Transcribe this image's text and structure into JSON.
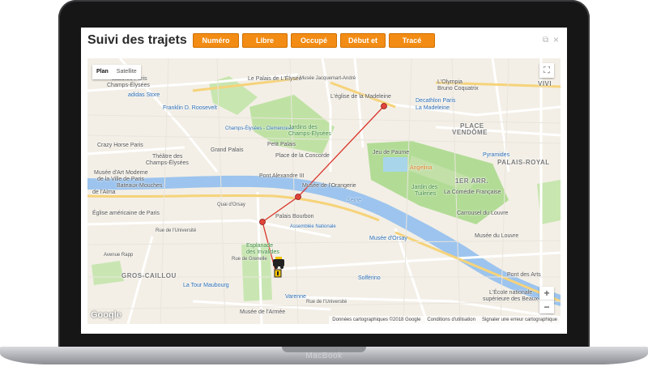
{
  "device": {
    "brand": "MacBook"
  },
  "app": {
    "title": "Suivi des trajets"
  },
  "filters": [
    {
      "label": "Numéro"
    },
    {
      "label": "Libre"
    },
    {
      "label": "Occupé"
    },
    {
      "label": "Début et"
    },
    {
      "label": "Tracé"
    }
  ],
  "window": {
    "popout_icon": "⧉",
    "close_icon": "×"
  },
  "map": {
    "type_control": {
      "plan": "Plan",
      "satellite": "Satellite"
    },
    "fullscreen_icon": "⛶",
    "zoom_in": "+",
    "zoom_out": "−",
    "logo": "Google",
    "attribution": {
      "data": "Données cartographiques ©2018 Google",
      "terms": "Conditions d'utilisation",
      "report": "Signaler une erreur cartographique"
    },
    "route_color": "#d9352c",
    "labels": [
      {
        "text": "Ladurée Paris",
        "cls": "dark"
      },
      {
        "text": "Champs-Élysées",
        "cls": "dark"
      },
      {
        "text": "adidas Store",
        "cls": "blue"
      },
      {
        "text": "Le Palais de L'Élysée",
        "cls": "dark"
      },
      {
        "text": "Musée Jacquemart-André",
        "cls": "dark small"
      },
      {
        "text": "L'Olympia",
        "cls": "dark"
      },
      {
        "text": "Bruno Coquatrix",
        "cls": "dark"
      },
      {
        "text": "VIVI",
        "cls": "big"
      },
      {
        "text": "Franklin D. Roosevelt",
        "cls": "blue"
      },
      {
        "text": "L'église de la Madeleine",
        "cls": "dark"
      },
      {
        "text": "Decathlon Paris",
        "cls": "blue"
      },
      {
        "text": "La Madeleine",
        "cls": "blue"
      },
      {
        "text": "Champs-Élysées - Clemenceau",
        "cls": "blue small"
      },
      {
        "text": "Jardins des",
        "cls": "green"
      },
      {
        "text": "Champs-Élysées",
        "cls": "green"
      },
      {
        "text": "PLACE",
        "cls": "big"
      },
      {
        "text": "VENDÔME",
        "cls": "big"
      },
      {
        "text": "Crazy Horse Paris",
        "cls": "dark"
      },
      {
        "text": "Petit Palais",
        "cls": "dark"
      },
      {
        "text": "Théâtre des",
        "cls": "dark"
      },
      {
        "text": "Champs-Élysées",
        "cls": "dark"
      },
      {
        "text": "Grand Palais",
        "cls": "dark"
      },
      {
        "text": "Place de la Concorde",
        "cls": "dark"
      },
      {
        "text": "Pyramides",
        "cls": "blue"
      },
      {
        "text": "Jeu de Paume",
        "cls": "dark"
      },
      {
        "text": "PALAIS-ROYAL",
        "cls": "big"
      },
      {
        "text": "Musée d'Art Moderne",
        "cls": "dark"
      },
      {
        "text": "de la Ville de Paris",
        "cls": "dark"
      },
      {
        "text": "Angelina",
        "cls": "orange"
      },
      {
        "text": "Pont Alexandre III",
        "cls": "dark"
      },
      {
        "text": "1ER ARR.",
        "cls": "big"
      },
      {
        "text": "Bateaux-Mouches",
        "cls": "dark"
      },
      {
        "text": "Musée de l'Orangerie",
        "cls": "dark"
      },
      {
        "text": "Jardin des",
        "cls": "green"
      },
      {
        "text": "Tuileries",
        "cls": "green"
      },
      {
        "text": "La Comédie Française",
        "cls": "dark"
      },
      {
        "text": "de l'Alma",
        "cls": "dark"
      },
      {
        "text": "Seine",
        "cls": "water"
      },
      {
        "text": "Église américaine de Paris",
        "cls": "dark"
      },
      {
        "text": "Palais Bourbon",
        "cls": "dark"
      },
      {
        "text": "Carrousel du Louvre",
        "cls": "dark"
      },
      {
        "text": "Assemblée Nationale",
        "cls": "blue small"
      },
      {
        "text": "Musée du Louvre",
        "cls": "dark"
      },
      {
        "text": "Musée d'Orsay",
        "cls": "blue"
      },
      {
        "text": "Rue de l'Université",
        "cls": "dark small"
      },
      {
        "text": "Esplanade",
        "cls": "green"
      },
      {
        "text": "des Invalides",
        "cls": "green"
      },
      {
        "text": "GROS-CAILLOU",
        "cls": "big"
      },
      {
        "text": "Pont des Arts",
        "cls": "dark"
      },
      {
        "text": "Rue de Grenelle",
        "cls": "dark small"
      },
      {
        "text": "La Tour Maubourg",
        "cls": "blue"
      },
      {
        "text": "Solférino",
        "cls": "blue"
      },
      {
        "text": "Varenne",
        "cls": "blue"
      },
      {
        "text": "L'École nationale",
        "cls": "dark"
      },
      {
        "text": "supérieure des Beaux-...",
        "cls": "dark"
      },
      {
        "text": "Musée de l'Armée",
        "cls": "dark"
      },
      {
        "text": "Rue de l'Université",
        "cls": "dark small"
      },
      {
        "text": "Quai d'Orsay",
        "cls": "dark small"
      },
      {
        "text": "Avenue Rapp",
        "cls": "dark small"
      }
    ]
  }
}
